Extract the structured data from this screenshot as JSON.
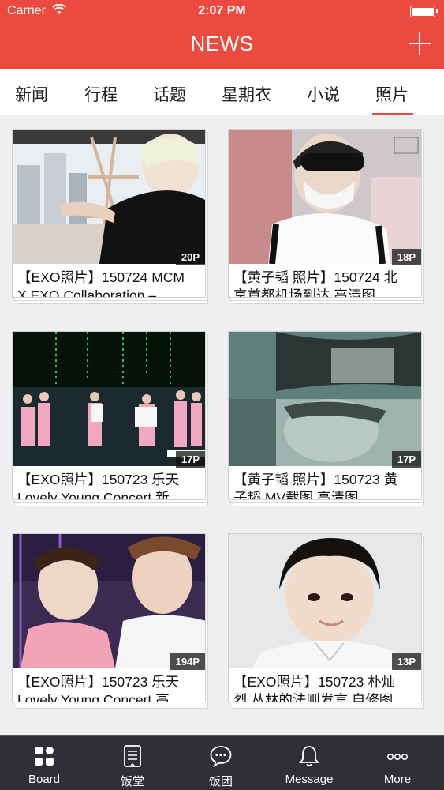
{
  "status_bar": {
    "carrier": "Carrier",
    "time": "2:07 PM"
  },
  "header": {
    "title": "NEWS"
  },
  "tabs": [
    {
      "label": "新闻"
    },
    {
      "label": "行程"
    },
    {
      "label": "话题"
    },
    {
      "label": "星期衣"
    },
    {
      "label": "小说"
    },
    {
      "label": "照片",
      "active": true
    }
  ],
  "cards": [
    {
      "caption_line1": "【EXO照片】150724 MCM",
      "caption_line2": "X EXO Collaboration –",
      "count": "20P"
    },
    {
      "caption_line1": "【黄子韬 照片】150724 北",
      "caption_line2": "京首都机场到达 高清图",
      "count": "18P"
    },
    {
      "caption_line1": "【EXO照片】150723 乐天",
      "caption_line2": "Lovely Young Concert 新",
      "count": "17P"
    },
    {
      "caption_line1": "【黄子韬 照片】150723 黄",
      "caption_line2": "子韬 MV载图 高清图",
      "count": "17P"
    },
    {
      "caption_line1": "【EXO照片】150723 乐天",
      "caption_line2": "Lovely Young Concert 高",
      "count": "194P"
    },
    {
      "caption_line1": "【EXO照片】150723 朴灿",
      "caption_line2": "烈 丛林的法则发言 自修图",
      "count": "13P"
    }
  ],
  "bottom_nav": [
    {
      "label": "Board",
      "icon": "board-grid-icon"
    },
    {
      "label": "饭堂",
      "icon": "document-icon"
    },
    {
      "label": "饭团",
      "icon": "chat-bubble-icon"
    },
    {
      "label": "Message",
      "icon": "bell-icon"
    },
    {
      "label": "More",
      "icon": "more-dots-icon"
    }
  ],
  "colors": {
    "accent": "#ec4a3f",
    "tabbar": "#2f2f35"
  }
}
